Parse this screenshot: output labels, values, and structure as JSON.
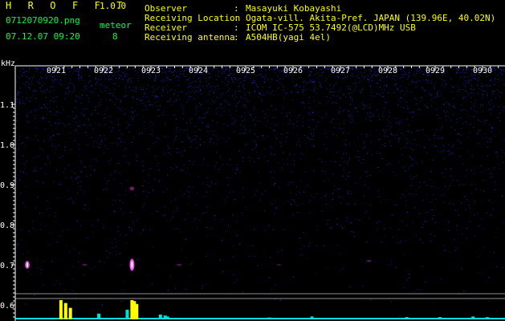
{
  "header": {
    "app_title": "H R O F F T",
    "version": "1.0.0",
    "filename": "0712070920.png",
    "meteor_label": "meteor",
    "datetime": "07.12.07 09:20",
    "meteor_count": "8"
  },
  "station_info": [
    {
      "label": "Observer",
      "value": "Masayuki Kobayashi"
    },
    {
      "label": "Receiving Location",
      "value": "Ogata-vill. Akita-Pref. JAPAN (139.96E, 40.02N)"
    },
    {
      "label": "Receiver",
      "value": "ICOM IC-575 53.7492(@LCD)MHz USB"
    },
    {
      "label": "Receiving antenna",
      "value": "A504HB(yagi 4el)"
    }
  ],
  "separator": ":",
  "colors": {
    "title": "#ffff00",
    "info": "#ffff00",
    "meta": "#00ff40",
    "axis": "#ffffff",
    "noise": "#2020c8",
    "echo": "#ff40ff",
    "echo_core": "#ffffff",
    "peak_yellow": "#ffff00",
    "peak_cyan": "#00e0e0"
  },
  "chart_data": {
    "type": "heatmap",
    "yaxis_unit": "kHz",
    "x_tick_labels": [
      "0921",
      "0922",
      "0923",
      "0924",
      "0925",
      "0926",
      "0927",
      "0928",
      "0929",
      "0930"
    ],
    "y_tick_labels": [
      "1.1",
      "1.0",
      "0.9",
      "0.8",
      "0.7",
      "0.6"
    ],
    "y_ticks": [
      1.1,
      1.0,
      0.9,
      0.8,
      0.7,
      0.6
    ],
    "ylim": [
      0.58,
      1.2
    ],
    "xlim": [
      9.2,
      10.2
    ],
    "reference_lines_khz": [
      0.6,
      0.612
    ],
    "echoes": [
      {
        "minute": 9.2,
        "freq_khz": 0.7,
        "strength": 0.8,
        "extent_khz": 0.02
      },
      {
        "minute": 22.6,
        "freq_khz": 0.7,
        "strength": 1.0,
        "extent_khz": 0.03
      },
      {
        "minute": 22.6,
        "freq_khz": 0.89,
        "strength": 0.4,
        "extent_khz": 0.01
      },
      {
        "minute": 21.6,
        "freq_khz": 0.7,
        "strength": 0.3,
        "extent_khz": 0.005
      },
      {
        "minute": 23.6,
        "freq_khz": 0.7,
        "strength": 0.3,
        "extent_khz": 0.005
      },
      {
        "minute": 27.6,
        "freq_khz": 0.71,
        "strength": 0.3,
        "extent_khz": 0.005
      },
      {
        "minute": 25.7,
        "freq_khz": 0.7,
        "strength": 0.2,
        "extent_khz": 0.005
      }
    ],
    "activity_bars": [
      {
        "minute": 21.1,
        "level": 1.0,
        "color": "yellow"
      },
      {
        "minute": 21.2,
        "level": 0.85,
        "color": "yellow"
      },
      {
        "minute": 21.3,
        "level": 0.6,
        "color": "yellow"
      },
      {
        "minute": 22.6,
        "level": 1.0,
        "color": "yellow"
      },
      {
        "minute": 22.65,
        "level": 0.95,
        "color": "yellow"
      },
      {
        "minute": 22.7,
        "level": 0.8,
        "color": "yellow"
      },
      {
        "minute": 22.5,
        "level": 0.5,
        "color": "cyan"
      },
      {
        "minute": 21.9,
        "level": 0.3,
        "color": "cyan"
      },
      {
        "minute": 23.2,
        "level": 0.25,
        "color": "cyan"
      },
      {
        "minute": 23.3,
        "level": 0.2,
        "color": "cyan"
      },
      {
        "minute": 23.35,
        "level": 0.15,
        "color": "cyan"
      },
      {
        "minute": 25.5,
        "level": 0.1,
        "color": "cyan"
      },
      {
        "minute": 26.4,
        "level": 0.15,
        "color": "cyan"
      },
      {
        "minute": 28.4,
        "level": 0.12,
        "color": "cyan"
      },
      {
        "minute": 29.1,
        "level": 0.12,
        "color": "cyan"
      },
      {
        "minute": 29.8,
        "level": 0.15,
        "color": "cyan"
      },
      {
        "minute": 30.1,
        "level": 0.12,
        "color": "cyan"
      }
    ]
  }
}
